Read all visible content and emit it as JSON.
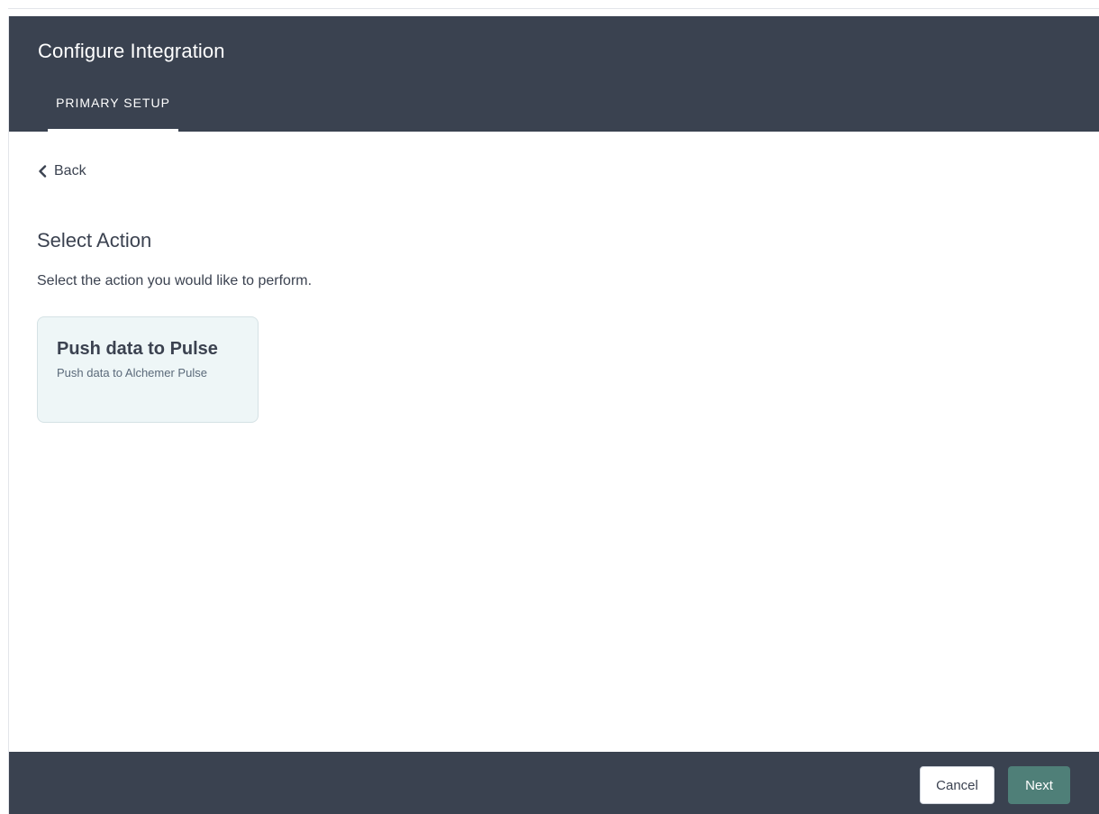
{
  "header": {
    "title": "Configure Integration",
    "tabs": [
      {
        "label": "PRIMARY SETUP",
        "active": true
      }
    ]
  },
  "nav": {
    "back_label": "Back",
    "back_icon": "chevron-left-icon"
  },
  "main": {
    "section_title": "Select Action",
    "section_description": "Select the action you would like to perform.",
    "actions": [
      {
        "title": "Push data to Pulse",
        "subtitle": "Push data to Alchemer Pulse"
      }
    ]
  },
  "footer": {
    "cancel_label": "Cancel",
    "next_label": "Next"
  },
  "colors": {
    "header_bg": "#3a4250",
    "card_bg": "#eef6f7",
    "primary_button": "#4f7f78",
    "text": "#3b4250"
  }
}
